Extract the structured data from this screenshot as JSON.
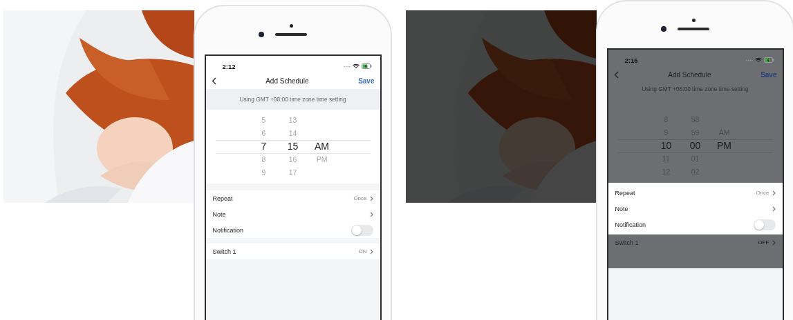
{
  "scenes": [
    {
      "dimmed": false,
      "screen": {
        "time": "2:12",
        "title": "Add Schedule",
        "save": "Save",
        "zone_note": "Using GMT +08:00 time zone time setting",
        "picker": [
          {
            "items": [
              {
                "text": "5",
                "selected": false
              },
              {
                "text": "6",
                "selected": false
              },
              {
                "text": "7",
                "selected": true
              },
              {
                "text": "8",
                "selected": false
              },
              {
                "text": "9",
                "selected": false
              }
            ]
          },
          {
            "items": [
              {
                "text": "13",
                "selected": false
              },
              {
                "text": "14",
                "selected": false
              },
              {
                "text": "15",
                "selected": true
              },
              {
                "text": "16",
                "selected": false
              },
              {
                "text": "17",
                "selected": false
              }
            ]
          },
          {
            "items": [
              {
                "text": "AM",
                "selected": true
              },
              {
                "text": "PM",
                "selected": false
              }
            ]
          }
        ],
        "settings": {
          "rows": [
            {
              "kind": "link",
              "label": "Repeat",
              "value": "Once"
            },
            {
              "kind": "link",
              "label": "Note"
            },
            {
              "kind": "toggle",
              "label": "Notification",
              "on": false
            }
          ]
        },
        "switch_row": {
          "label": "Switch 1",
          "value": "ON"
        }
      }
    },
    {
      "dimmed": true,
      "screen": {
        "time": "2:16",
        "title": "Add Schedule",
        "save": "Save",
        "zone_note": "Using GMT +08:00 time zone time setting",
        "picker": [
          {
            "items": [
              {
                "text": "8",
                "selected": false
              },
              {
                "text": "9",
                "selected": false
              },
              {
                "text": "10",
                "selected": true
              },
              {
                "text": "11",
                "selected": false
              },
              {
                "text": "12",
                "selected": false
              }
            ]
          },
          {
            "items": [
              {
                "text": "58",
                "selected": false
              },
              {
                "text": "59",
                "selected": false
              },
              {
                "text": "00",
                "selected": true
              },
              {
                "text": "01",
                "selected": false
              },
              {
                "text": "02",
                "selected": false
              }
            ]
          },
          {
            "items": [
              {
                "text": "AM",
                "selected": false
              },
              {
                "text": "PM",
                "selected": true
              }
            ]
          }
        ],
        "settings": {
          "rows": [
            {
              "kind": "link",
              "label": "Repeat",
              "value": "Once"
            },
            {
              "kind": "link",
              "label": "Note"
            },
            {
              "kind": "toggle",
              "label": "Notification",
              "on": false
            }
          ]
        },
        "switch_row": {
          "label": "Switch 1",
          "value": "OFF"
        }
      }
    }
  ]
}
